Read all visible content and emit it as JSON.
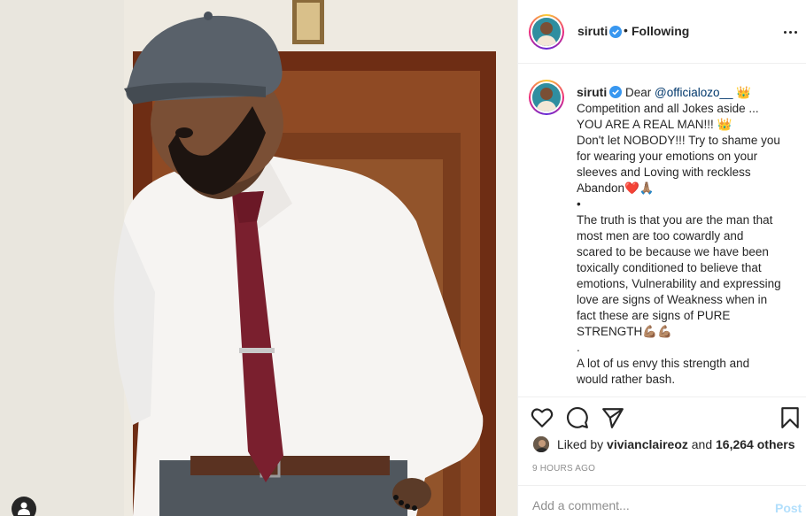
{
  "post": {
    "username": "siruti",
    "verified": true,
    "separator": "•",
    "follow_label": "Following",
    "more_icon": "more-horizontal-icon"
  },
  "caption": {
    "lines": [
      "Dear @officialozo__ 👑",
      "Competition and all Jokes aside ...",
      "YOU ARE A REAL MAN!!! 👑",
      "Don't let NOBODY!!! Try to shame you",
      "for wearing your emotions on your",
      "sleeves and Loving with reckless",
      "Abandon❤️🙏🏽",
      "•",
      "The truth is that you are the man that",
      "most men are too cowardly and",
      "scared to be because we have been",
      "toxically conditioned to believe that",
      "emotions, Vulnerability and expressing",
      "love are signs of Weakness when in",
      "fact these are signs of PURE",
      "STRENGTH💪🏽💪🏽",
      ".",
      "A lot of us envy this strength and",
      "would rather bash."
    ]
  },
  "actions": {
    "like_icon": "heart-icon",
    "comment_icon": "comment-icon",
    "share_icon": "paper-plane-icon",
    "save_icon": "bookmark-icon"
  },
  "likes": {
    "prefix": "Liked by",
    "user": "vivianclaireoz",
    "middle": "and",
    "count": "16,264 others"
  },
  "timestamp": "9 HOURS AGO",
  "comment": {
    "placeholder": "Add a comment...",
    "post_label": "Post"
  },
  "colors": {
    "text": "#262626",
    "secondary": "#8e8e8e",
    "link": "#00376b",
    "verified": "#3897f0",
    "post_disabled": "#b2dffc",
    "divider": "#efefef"
  }
}
